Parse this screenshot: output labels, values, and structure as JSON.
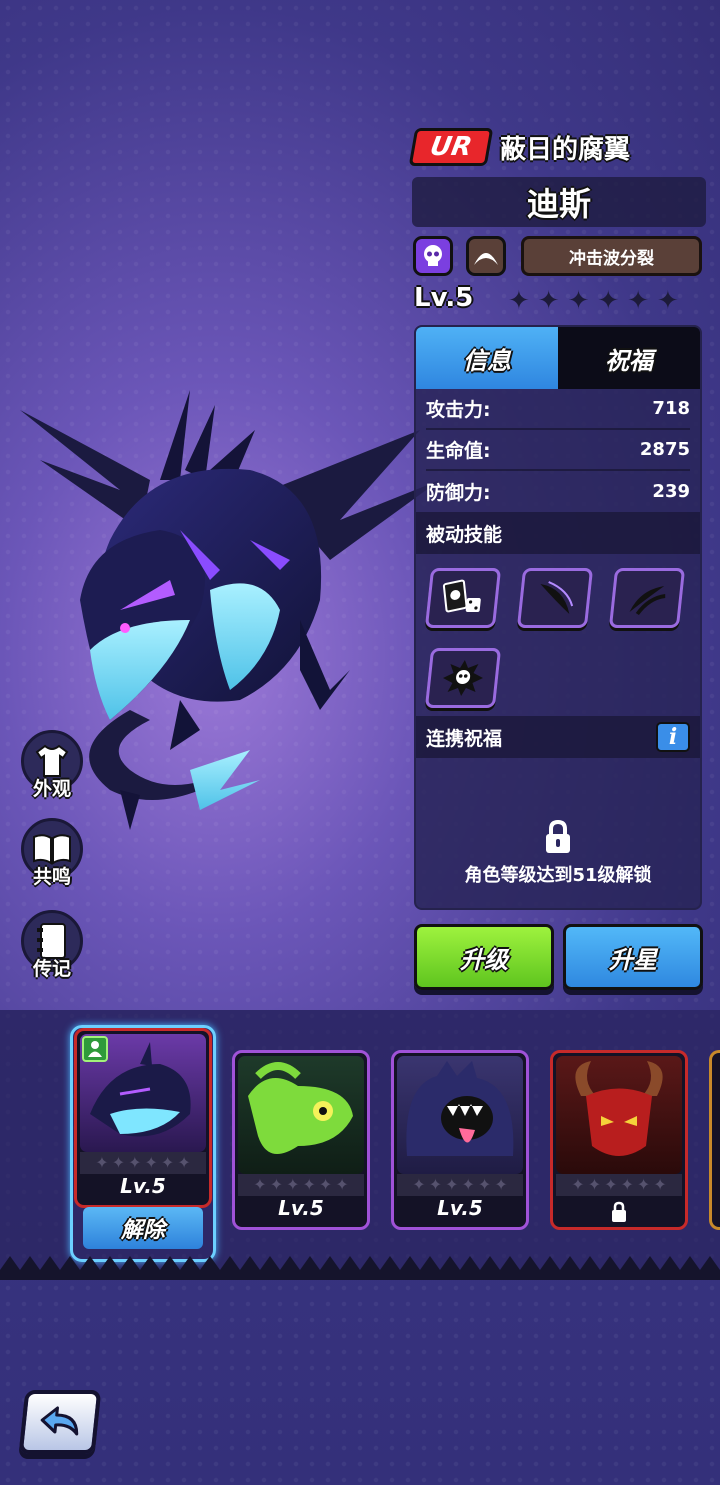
{
  "character": {
    "rarity": "UR",
    "title": "蔽日的腐翼",
    "name": "迪斯",
    "type_icons": [
      "skull-icon",
      "horn-icon"
    ],
    "active_skill": "冲击波分裂",
    "level": "Lv.5",
    "stars_filled": 0,
    "stars_total": 6
  },
  "tabs": [
    {
      "label": "信息",
      "active": true
    },
    {
      "label": "祝福",
      "active": false
    }
  ],
  "stats": [
    {
      "label": "攻击力:",
      "value": "718"
    },
    {
      "label": "生命值:",
      "value": "2875"
    },
    {
      "label": "防御力:",
      "value": "239"
    }
  ],
  "passive_section": {
    "title": "被动技能",
    "skills": [
      "cards-dice-icon",
      "wing-slash-icon",
      "claw-slash-icon",
      "skull-burst-icon"
    ]
  },
  "blessing_section": {
    "title": "连携祝福",
    "info_label": "i",
    "lock_text": "角色等级达到51级解锁"
  },
  "buttons": {
    "upgrade": "升级",
    "star_up": "升星",
    "release": "解除"
  },
  "side_menu": [
    {
      "label": "外观",
      "icon": "shirt-icon"
    },
    {
      "label": "共鸣",
      "icon": "book-icon"
    },
    {
      "label": "传记",
      "icon": "notebook-icon"
    }
  ],
  "roster": [
    {
      "level": "Lv.5",
      "selected": true,
      "equipped": true,
      "locked": false,
      "frame": "#c72a2a"
    },
    {
      "level": "Lv.5",
      "selected": false,
      "equipped": false,
      "locked": false,
      "frame": "#a052d8"
    },
    {
      "level": "Lv.5",
      "selected": false,
      "equipped": false,
      "locked": false,
      "frame": "#a052d8"
    },
    {
      "level": "",
      "selected": false,
      "equipped": false,
      "locked": true,
      "frame": "#c72a2a"
    }
  ],
  "colors": {
    "ur_red": "#e8262b",
    "tab_blue": "#3a98ea",
    "upgrade_green": "#7ed42e",
    "star_blue": "#3a98ea"
  }
}
